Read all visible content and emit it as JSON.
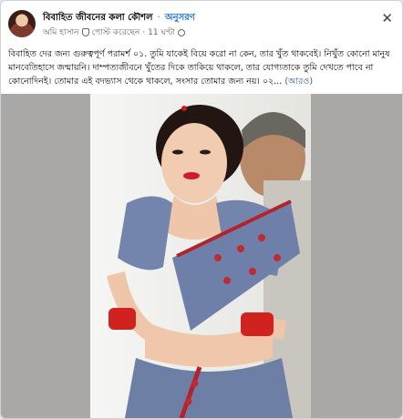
{
  "post": {
    "group_name": "বিবাহিত জীবনের কলা কৌশল",
    "separator": "·",
    "follow_label": "অনুসরণ",
    "author": "অমি হাসান",
    "posted_label": "পোস্ট করেছেন",
    "time": "11 ঘণ্টা",
    "text": "বিবাহিত দের জন্য গুরুত্বপূর্ণ পরামর্শ ০১. তুমি যাকেই বিয়ে করো না কেন, তার খুঁত থাকবেই। নিখুঁত কোনো মানুষ মানবেতিহাসে জন্মায়নি। দাম্পত্যজীবনে খুঁতের দিকে তাকিয়ে থাকলে, তার যোগ্যতাকে তুমি দেখতে পাবে না কোনোদিনই। তোমার এই বদভ্যাস থেকে থাকলে, সংসার তোমার জন্য নয়। ০২...",
    "see_more": "(আরও)"
  },
  "icons": {
    "close": "close-icon",
    "audience": "shield-icon",
    "visibility": "globe-icon"
  },
  "colors": {
    "link": "#1b74e4",
    "see_more": "#385898",
    "photo_bg": "#a9a8a7",
    "saree": "#6d7fa8",
    "bangles": "#d0221f"
  }
}
